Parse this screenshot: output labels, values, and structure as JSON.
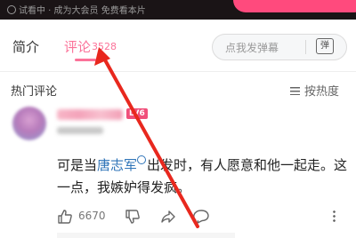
{
  "top_bar": {
    "trial_text": "试看中 · 成为大会员 免费看本片"
  },
  "tabs": [
    {
      "label": "简介"
    },
    {
      "label": "评论",
      "count": "3528"
    }
  ],
  "danmaku": {
    "placeholder": "点我发弹幕",
    "icon_text": "弹"
  },
  "hot_comments": {
    "title": "热门评论",
    "sort_label": "按热度"
  },
  "comment": {
    "level": "LV6",
    "text_before": "可是当",
    "link_text": "唐志军",
    "text_after": "出发时，有人愿意和他一起走。这一点，我嫉妒得发疯。",
    "like_count": "6670"
  },
  "colors": {
    "accent": "#fb7299",
    "link": "#2f74b8",
    "annotation_arrow": "#e8281e",
    "vip_button": "#ff4a7d"
  },
  "icons": [
    "play-icon",
    "danmaku-icon",
    "sort-icon",
    "like-icon",
    "dislike-icon",
    "share-icon",
    "reply-icon",
    "more-icon",
    "search-link-icon"
  ]
}
